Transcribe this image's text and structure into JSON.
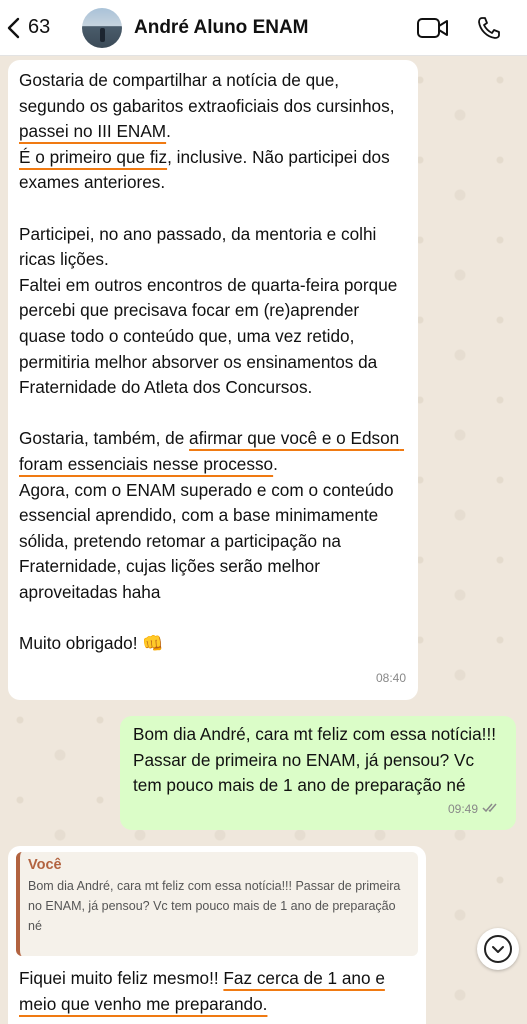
{
  "header": {
    "back_count": "63",
    "contact_name": "André Aluno ENAM"
  },
  "messages": [
    {
      "direction": "incoming",
      "p1_a": "Gostaria de compartilhar a notícia de que, segundo os gabaritos extraoficiais dos cursinhos, ",
      "p1_u1": "passei no III ENAM",
      "p1_b": ".\n",
      "p1_u2": "É o primeiro que fiz",
      "p1_c": ", inclusive. Não participei dos exames anteriores.",
      "p2": "Participei, no ano passado, da mentoria e colhi ricas lições.\nFaltei em outros encontros de quarta-feira porque percebi que precisava focar em (re)aprender quase todo o conteúdo que, uma vez retido, permitiria melhor absorver os ensinamentos da Fraternidade do Atleta dos Concursos.",
      "p3_a": "Gostaria, também, de ",
      "p3_u": "afirmar que você e o Edson foram essenciais nesse processo",
      "p3_b": ".\nAgora, com o ENAM superado e com o conteúdo essencial aprendido, com a base minimamente sólida, pretendo retomar a participação na Fraternidade, cujas lições serão melhor aproveitadas haha",
      "p4": "Muito obrigado! 👊",
      "time": "08:40"
    },
    {
      "direction": "outgoing",
      "text": "Bom dia André, cara mt feliz com essa notícia!!! Passar de primeira no ENAM, já pensou? Vc tem pouco mais de 1 ano de preparação né",
      "time": "09:49",
      "status": "read"
    },
    {
      "direction": "incoming",
      "quote_author": "Você",
      "quote_text": "Bom dia André, cara mt feliz com essa notícia!!! Passar de primeira no ENAM, já pensou? Vc tem pouco mais de 1 ano de preparação né",
      "text_a": "Fiquei muito feliz mesmo!! ",
      "text_u": "Faz cerca de 1 ano e meio que venho me preparando."
    }
  ],
  "colors": {
    "incoming_bg": "#ffffff",
    "outgoing_bg": "#dbfdc8",
    "underline": "#f07a12",
    "quote_accent": "#b26340"
  },
  "icons": [
    "chevron-left-icon",
    "video-call-icon",
    "phone-icon",
    "double-check-icon",
    "chevron-down-icon"
  ]
}
